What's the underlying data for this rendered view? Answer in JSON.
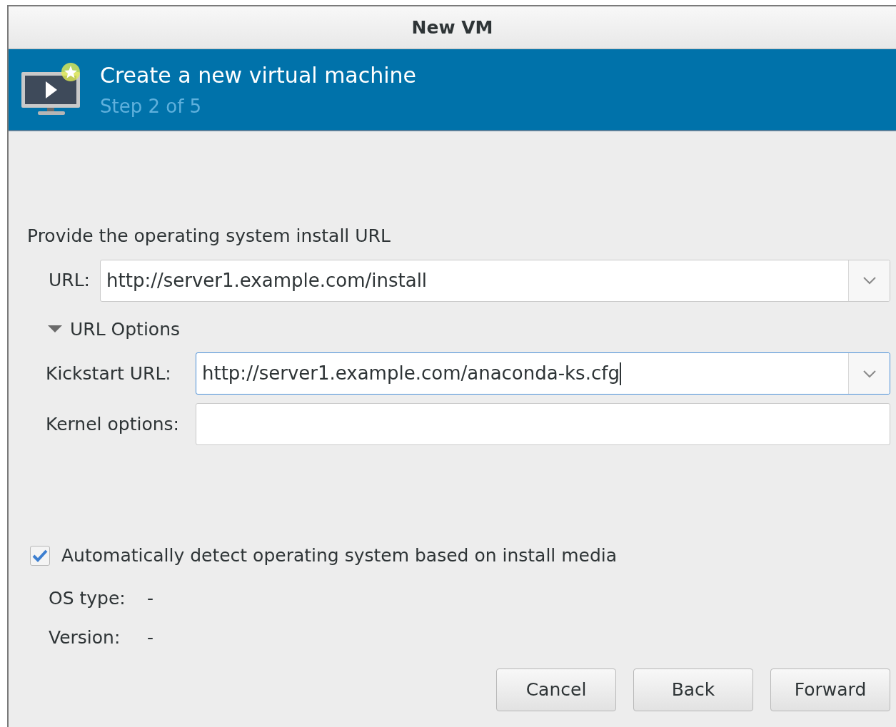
{
  "window": {
    "title": "New VM"
  },
  "banner": {
    "title": "Create a new virtual machine",
    "step": "Step 2 of 5"
  },
  "prompt": "Provide the operating system install URL",
  "url": {
    "label": "URL:",
    "value": "http://server1.example.com/install"
  },
  "url_options": {
    "label": "URL Options",
    "expanded": true
  },
  "kickstart": {
    "label": "Kickstart URL:",
    "value": "http://server1.example.com/anaconda-ks.cfg",
    "focused": true
  },
  "kernel": {
    "label": "Kernel options:"
  },
  "auto_detect": {
    "label": "Automatically detect operating system based on install media",
    "checked": true
  },
  "os_info": [
    {
      "label": "OS type:",
      "value": "-"
    },
    {
      "label": "Version:",
      "value": "-"
    }
  ],
  "buttons": [
    "Cancel",
    "Back",
    "Forward"
  ]
}
